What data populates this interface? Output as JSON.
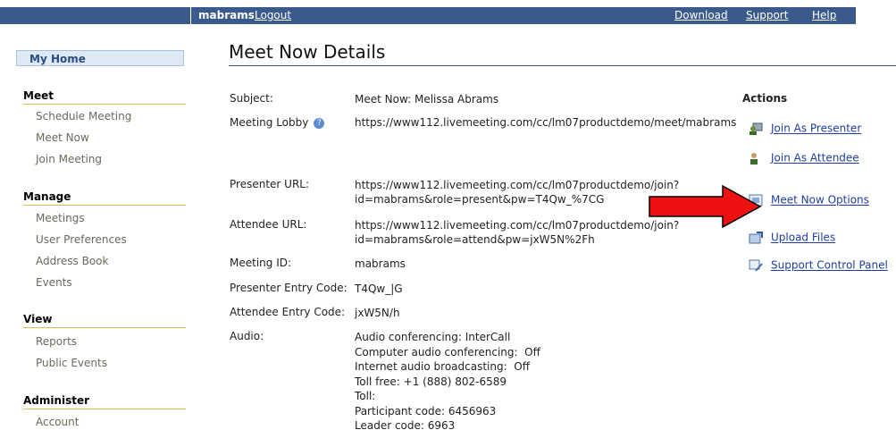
{
  "topbar": {
    "user": "mabrams",
    "logout": "Logout",
    "download": "Download",
    "support": "Support",
    "help": "Help"
  },
  "nav": {
    "my_home": "My Home",
    "sections": [
      {
        "heading": "Meet",
        "items": [
          "Schedule Meeting",
          "Meet Now",
          "Join Meeting"
        ]
      },
      {
        "heading": "Manage",
        "items": [
          "Meetings",
          "User Preferences",
          "Address Book",
          "Events"
        ]
      },
      {
        "heading": "View",
        "items": [
          "Reports",
          "Public Events"
        ]
      },
      {
        "heading": "Administer",
        "items": [
          "Account"
        ]
      }
    ]
  },
  "main": {
    "title": "Meet Now Details",
    "rows": [
      {
        "label": "Subject:",
        "value": "Meet Now: Melissa Abrams"
      },
      {
        "label": "Meeting Lobby",
        "value": "https://www112.livemeeting.com/cc/lm07productdemo/meet/mabrams"
      },
      {
        "label": "Presenter URL:",
        "value": "https://www112.livemeeting.com/cc/lm07productdemo/join?\nid=mabrams&role=present&pw=T4Qw_%7CG"
      },
      {
        "label": "Attendee URL:",
        "value": "https://www112.livemeeting.com/cc/lm07productdemo/join?\nid=mabrams&role=attend&pw=jxW5N%2Fh"
      },
      {
        "label": "Meeting ID:",
        "value": "mabrams"
      },
      {
        "label": "Presenter Entry Code:",
        "value": "T4Qw_|G"
      },
      {
        "label": "Attendee Entry Code:",
        "value": "jxW5N/h"
      },
      {
        "label": "Audio:",
        "value": "Audio conferencing: InterCall\nComputer audio conferencing:  Off\nInternet audio broadcasting:  Off\nToll free: +1 (888) 802-6589\nToll:\nParticipant code: 6456963\nLeader code: 6963"
      }
    ]
  },
  "actions": {
    "heading": "Actions",
    "items": [
      {
        "label": "Join As Presenter",
        "icon": "presenter-icon"
      },
      {
        "label": "Join As Attendee",
        "icon": "attendee-icon"
      },
      {
        "label": "Meet Now Options",
        "icon": "options-icon"
      },
      {
        "label": "Upload Files",
        "icon": "upload-icon"
      },
      {
        "label": "Support Control Panel",
        "icon": "control-panel-icon"
      }
    ]
  },
  "colors": {
    "topbar": "#3a5a8c",
    "link": "#1f3f9f",
    "arrow": "#ee1111"
  }
}
